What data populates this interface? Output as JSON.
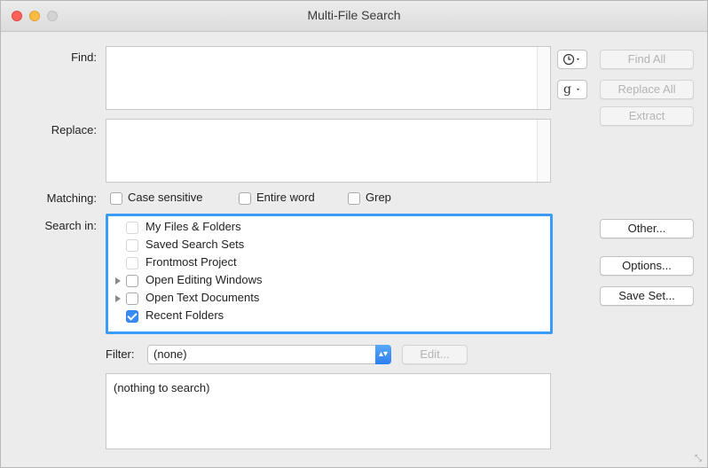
{
  "window": {
    "title": "Multi-File Search"
  },
  "find": {
    "label": "Find:",
    "value": ""
  },
  "replace": {
    "label": "Replace:",
    "value": ""
  },
  "matching": {
    "label": "Matching:",
    "options": [
      {
        "label": "Case sensitive",
        "checked": false
      },
      {
        "label": "Entire word",
        "checked": false
      },
      {
        "label": "Grep",
        "checked": false
      }
    ]
  },
  "search_in": {
    "label": "Search in:",
    "items": [
      {
        "label": "My Files & Folders",
        "checked": false,
        "expandable": false
      },
      {
        "label": "Saved Search Sets",
        "checked": false,
        "expandable": false
      },
      {
        "label": "Frontmost Project",
        "checked": false,
        "expandable": false
      },
      {
        "label": "Open Editing Windows",
        "checked": false,
        "expandable": true
      },
      {
        "label": "Open Text Documents",
        "checked": false,
        "expandable": true
      },
      {
        "label": "Recent Folders",
        "checked": true,
        "expandable": false
      }
    ]
  },
  "filter": {
    "label": "Filter:",
    "selected": "(none)",
    "edit_label": "Edit..."
  },
  "results": {
    "text": "(nothing to search)"
  },
  "buttons": {
    "find_all": "Find All",
    "replace_all": "Replace All",
    "extract": "Extract",
    "other": "Other...",
    "options": "Options...",
    "save_set": "Save Set..."
  },
  "icons": {
    "history": "clock-icon",
    "grep_patterns": "g-icon"
  },
  "colors": {
    "accent": "#3a9cf8",
    "close": "#fc605b",
    "minimize": "#fdbc40",
    "zoom_disabled": "#d3d3d3"
  }
}
